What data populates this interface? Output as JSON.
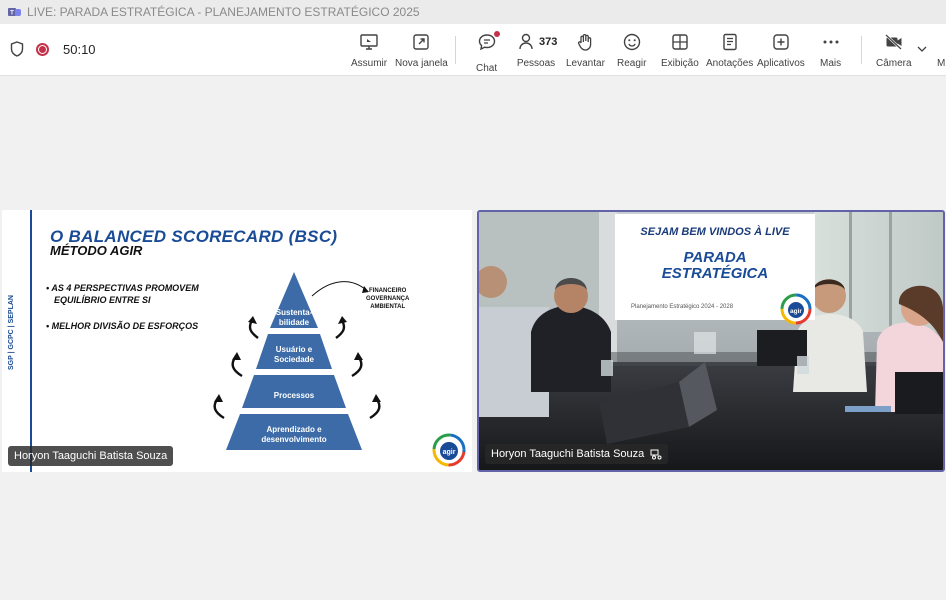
{
  "window": {
    "title": "LIVE: PARADA ESTRATÉGICA - PLANEJAMENTO ESTRATÉGICO 2025"
  },
  "meeting": {
    "timer": "50:10",
    "people_count": "373"
  },
  "toolbar": {
    "assumir": "Assumir",
    "nova_janela": "Nova janela",
    "chat": "Chat",
    "pessoas": "Pessoas",
    "levantar": "Levantar",
    "reagir": "Reagir",
    "exibicao": "Exibição",
    "anotacoes": "Anotações",
    "aplicativos": "Aplicativos",
    "mais": "Mais",
    "camera": "Câmera",
    "mic_partial": "Mi"
  },
  "slide": {
    "title": "O BALANCED SCORECARD (BSC)",
    "subtitle": "MÉTODO AGIR",
    "vertical_text": "SGP | GCPC | SEPLAN",
    "bullets": [
      "AS 4 PERSPECTIVAS PROMOVEM",
      "EQUILÍBRIO ENTRE SI",
      "MELHOR DIVISÃO DE ESFORÇOS"
    ],
    "pyramid": {
      "level1": [
        "Sustenta-",
        "bilidade"
      ],
      "level2": [
        "Usuário e",
        "Sociedade"
      ],
      "level3": "Processos",
      "level4": [
        "Aprendizado e",
        "desenvolvimento"
      ]
    },
    "annotation": [
      "FINANCEIRO",
      "GOVERNANÇA",
      "AMBIENTAL"
    ],
    "logo": "agir"
  },
  "video": {
    "banner_line1": "SEJAM BEM VINDOS À LIVE",
    "banner_line2a": "PARADA",
    "banner_line2b": "ESTRATÉGICA",
    "banner_line3": "Planejamento Estratégico    2024 - 2028",
    "logo": "agir"
  },
  "participants": {
    "left_name": "Horyon Taaguchi Batista Souza",
    "right_name": "Horyon Taaguchi Batista Souza"
  },
  "colors": {
    "accent": "#6264a7",
    "record": "#c4314b",
    "slide_blue": "#1a4b96"
  }
}
